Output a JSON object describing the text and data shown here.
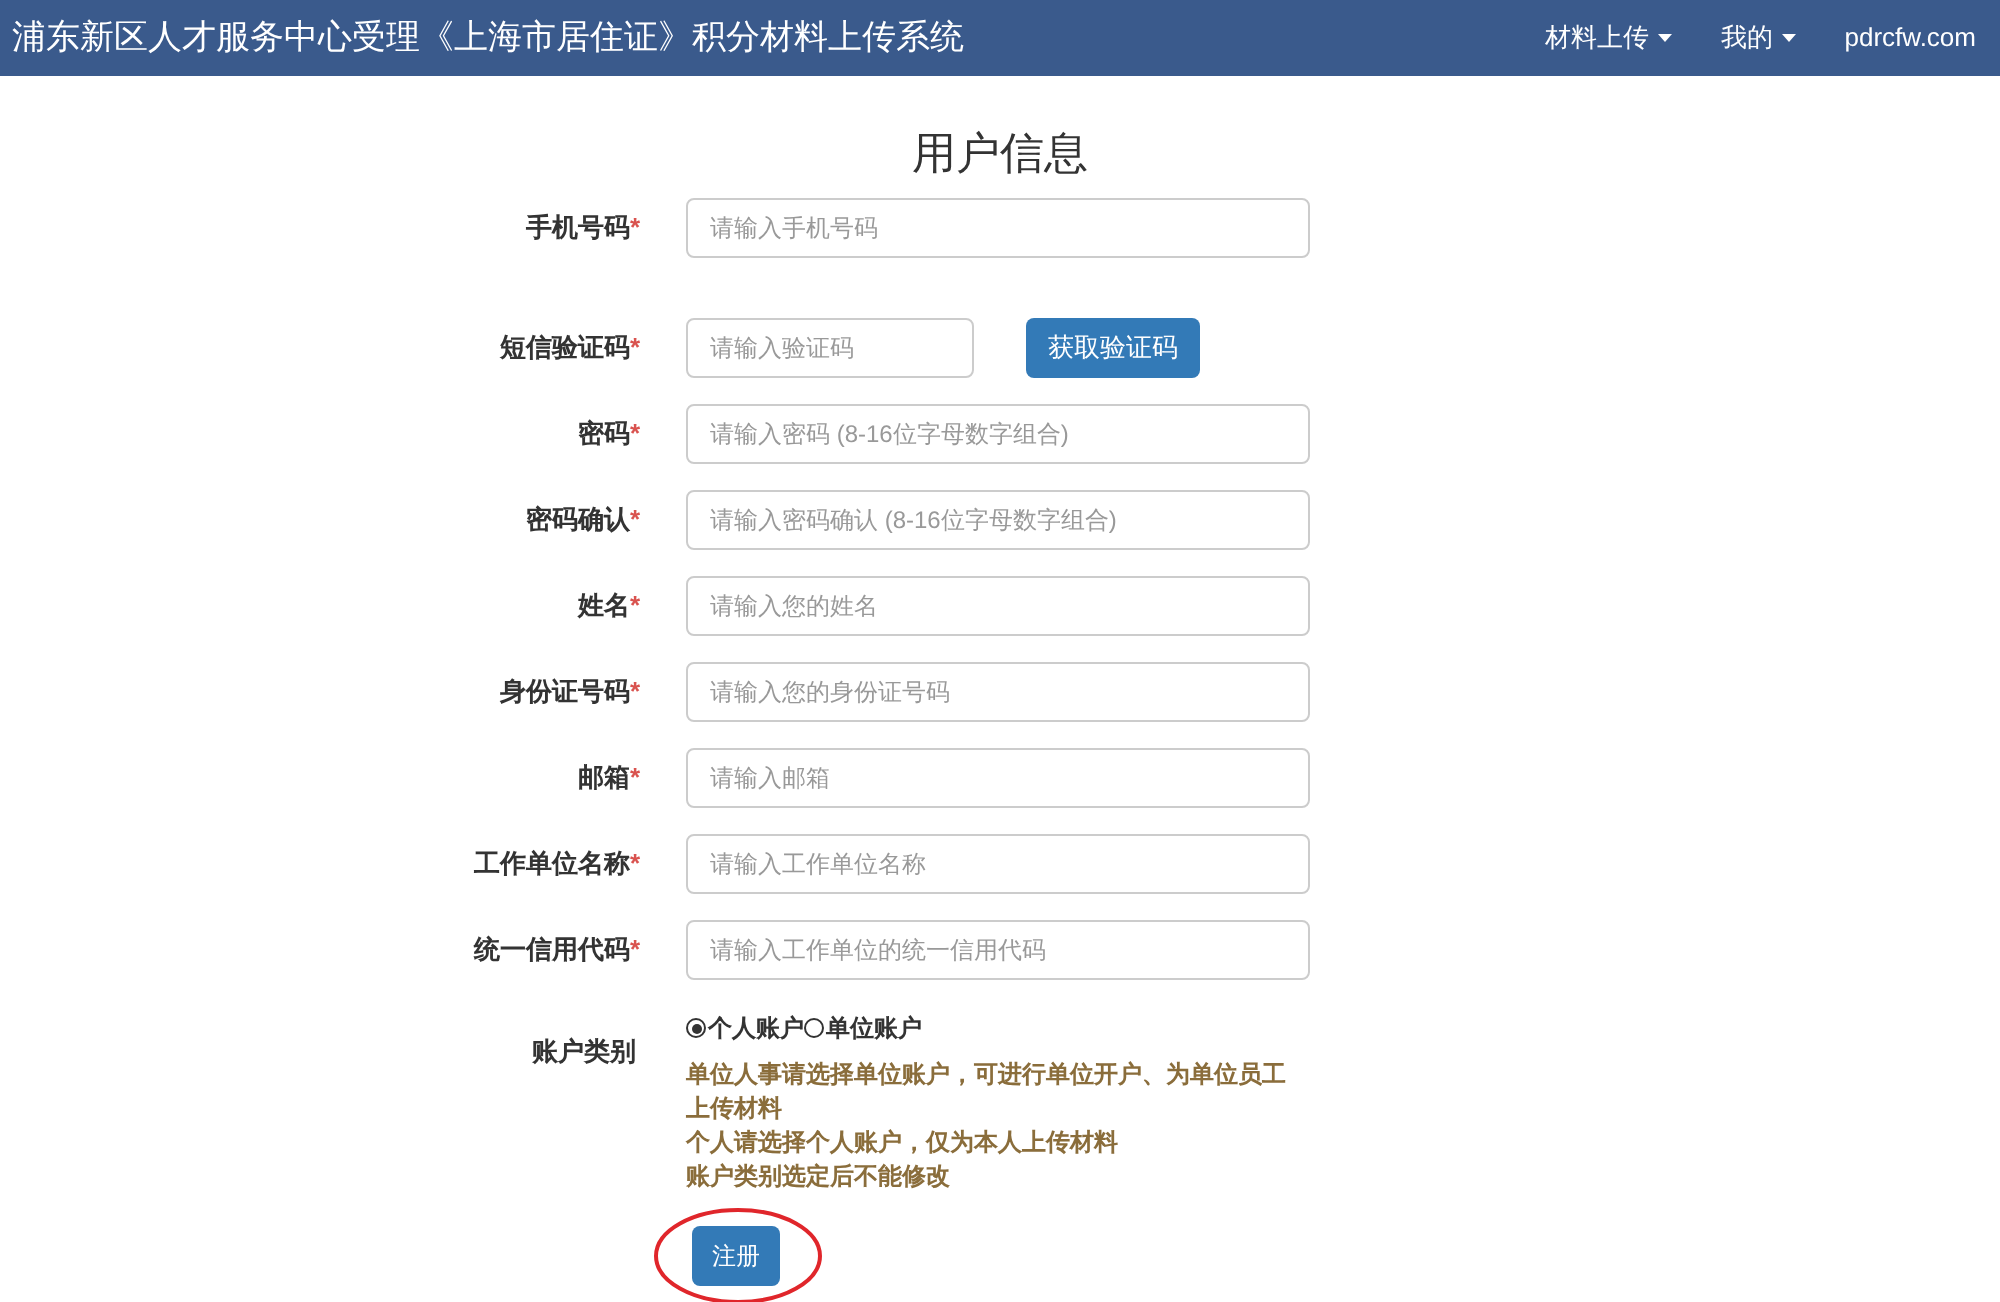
{
  "navbar": {
    "title": "浦东新区人才服务中心受理《上海市居住证》积分材料上传系统",
    "menus": [
      {
        "label": "材料上传",
        "dropdown": true
      },
      {
        "label": "我的",
        "dropdown": true
      }
    ],
    "site": "pdrcfw.com"
  },
  "form": {
    "title": "用户信息",
    "fields": [
      {
        "kind": "text",
        "label": "手机号码",
        "required_mark": "*",
        "placeholder": "请输入手机号码"
      },
      {
        "kind": "sms",
        "label": "短信验证码",
        "required_mark": "*",
        "placeholder": "请输入验证码",
        "button": "获取验证码"
      },
      {
        "kind": "text",
        "label": "密码",
        "required_mark": "*",
        "placeholder": "请输入密码 (8-16位字母数字组合)"
      },
      {
        "kind": "text",
        "label": "密码确认",
        "required_mark": "*",
        "placeholder": "请输入密码确认 (8-16位字母数字组合)"
      },
      {
        "kind": "text",
        "label": "姓名",
        "required_mark": "*",
        "placeholder": "请输入您的姓名"
      },
      {
        "kind": "text",
        "label": "身份证号码",
        "required_mark": "*",
        "placeholder": "请输入您的身份证号码"
      },
      {
        "kind": "text",
        "label": "邮箱",
        "required_mark": "*",
        "placeholder": "请输入邮箱"
      },
      {
        "kind": "text",
        "label": "工作单位名称",
        "required_mark": "*",
        "placeholder": "请输入工作单位名称"
      },
      {
        "kind": "text",
        "label": "统一信用代码",
        "required_mark": "*",
        "placeholder": "请输入工作单位的统一信用代码"
      }
    ],
    "account_type": {
      "label": "账户类别",
      "options": [
        {
          "label": "个人账户",
          "selected": true
        },
        {
          "label": "单位账户",
          "selected": false
        }
      ],
      "notes": [
        "单位人事请选择单位账户，可进行单位开户、为单位员工上传材料",
        "个人请选择个人账户，仅为本人上传材料",
        "账户类别选定后不能修改"
      ]
    },
    "submit": "注册",
    "submit_circled": true
  }
}
